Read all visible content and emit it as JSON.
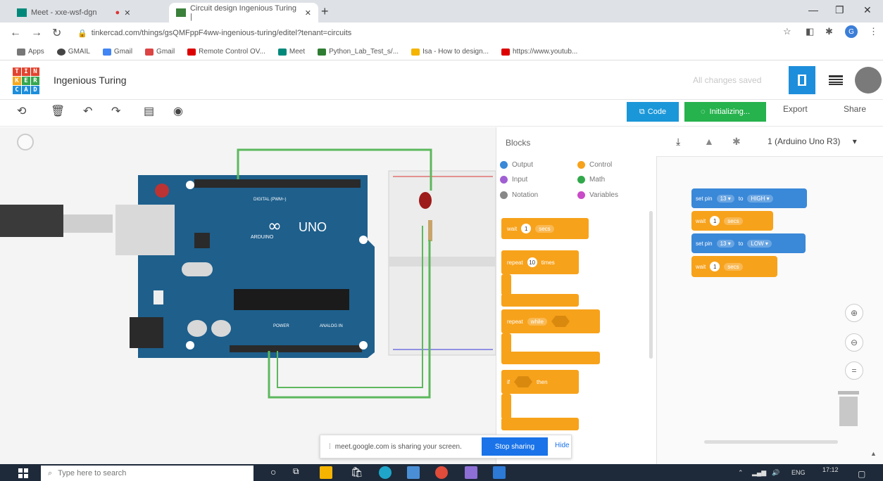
{
  "browser": {
    "tabs": [
      {
        "title": "Meet - xxe-wsf-dgn"
      },
      {
        "title": "Circuit design Ingenious Turing |"
      }
    ],
    "url": "tinkercad.com/things/gsQMFppF4ww-ingenious-turing/editel?tenant=circuits",
    "bookmarks": [
      "Apps",
      "GMAIL",
      "Gmail",
      "Gmail",
      "Remote Control OV...",
      "Meet",
      "Python_Lab_Test_s/...",
      "Isa - How to design...",
      "https://www.youtub..."
    ],
    "profile_initial": "G"
  },
  "header": {
    "logo_letters": [
      "T",
      "I",
      "N",
      "K",
      "E",
      "R",
      "C",
      "A",
      "D"
    ],
    "project_name": "Ingenious Turing",
    "save_status": "All changes saved"
  },
  "toolbar": {
    "code_label": "Code",
    "simulate_label": "Initializing...",
    "export_label": "Export",
    "share_label": "Share"
  },
  "palette": {
    "title": "Blocks",
    "categories": [
      {
        "label": "Output",
        "color": "#3a88d8"
      },
      {
        "label": "Control",
        "color": "#f7a21b"
      },
      {
        "label": "Input",
        "color": "#a05fd2"
      },
      {
        "label": "Math",
        "color": "#31a84a"
      },
      {
        "label": "Notation",
        "color": "#888888"
      },
      {
        "label": "Variables",
        "color": "#c94bc7"
      }
    ],
    "blocks": {
      "wait": "wait",
      "wait_value": "1",
      "wait_unit": "secs",
      "repeat": "repeat",
      "repeat_value": "10",
      "repeat_unit": "times",
      "repeat_while": "repeat",
      "while_label": "while",
      "if_label": "if",
      "then_label": "then"
    }
  },
  "code_panel": {
    "device": "1 (Arduino Uno R3)",
    "blocks": [
      {
        "kind": "set_pin",
        "label": "set pin",
        "pin": "13",
        "to": "to",
        "state": "HIGH"
      },
      {
        "kind": "wait",
        "label": "wait",
        "value": "1",
        "unit": "secs"
      },
      {
        "kind": "set_pin",
        "label": "set pin",
        "pin": "13",
        "to": "to",
        "state": "LOW"
      },
      {
        "kind": "wait",
        "label": "wait",
        "value": "1",
        "unit": "secs"
      }
    ]
  },
  "arduino": {
    "board_label": "UNO",
    "brand": "ARDUINO",
    "digital_label": "DIGITAL (PWM~)",
    "power_label": "POWER",
    "analog_label": "ANALOG IN"
  },
  "share_notice": {
    "message": "meet.google.com is sharing your screen.",
    "stop_label": "Stop sharing",
    "hide_label": "Hide"
  },
  "taskbar": {
    "search_placeholder": "Type here to search",
    "tray_lang": "ENG",
    "time": "17:12"
  },
  "colors": {
    "tinkercad_blue": "#1d8edb",
    "simulate_green": "#26b24d",
    "block_orange": "#f7a21b",
    "block_blue": "#3a88d8",
    "arduino_teal": "#1e5f8c",
    "wire_green": "#5cb85c"
  }
}
